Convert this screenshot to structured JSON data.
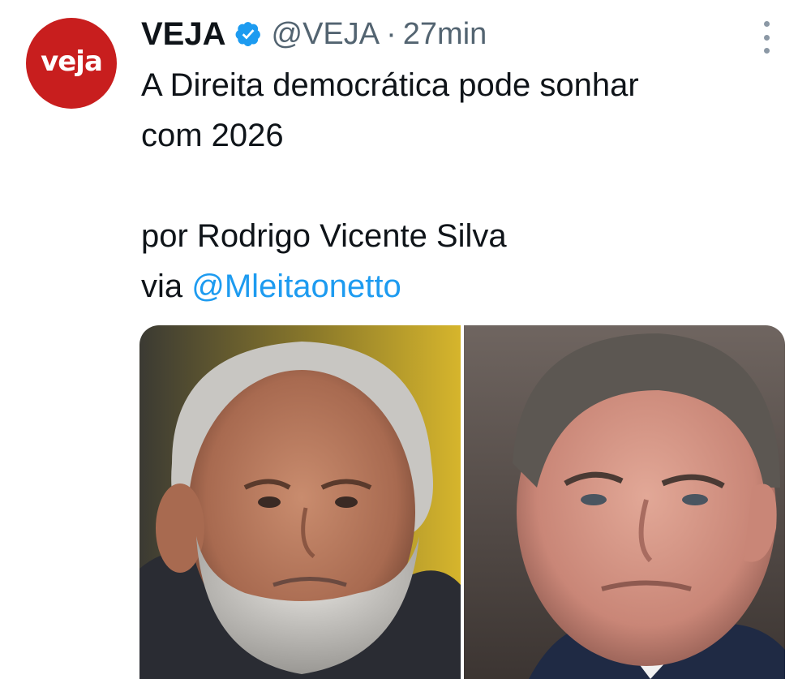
{
  "author": {
    "avatar_text": "veja",
    "display_name": "VEJA",
    "handle": "@VEJA",
    "separator": "·",
    "time": "27min",
    "verified": true
  },
  "tweet": {
    "line1": "A Direita democrática pode sonhar",
    "line2": "com 2026",
    "line3": "por Rodrigo Vicente Silva",
    "via": "via ",
    "mention": "@Mleitaonetto"
  },
  "media": {
    "left_photo": "portrait-photo-gray-bearded-man",
    "right_photo": "portrait-photo-gray-haired-man"
  },
  "icons": [
    "verified-badge-icon",
    "more-options-icon"
  ],
  "colors": {
    "avatar_bg": "#c81e1e",
    "verified": "#1d9bf0",
    "mention": "#1d9bf0",
    "secondary_text": "#536471",
    "primary_text": "#0f1419"
  }
}
